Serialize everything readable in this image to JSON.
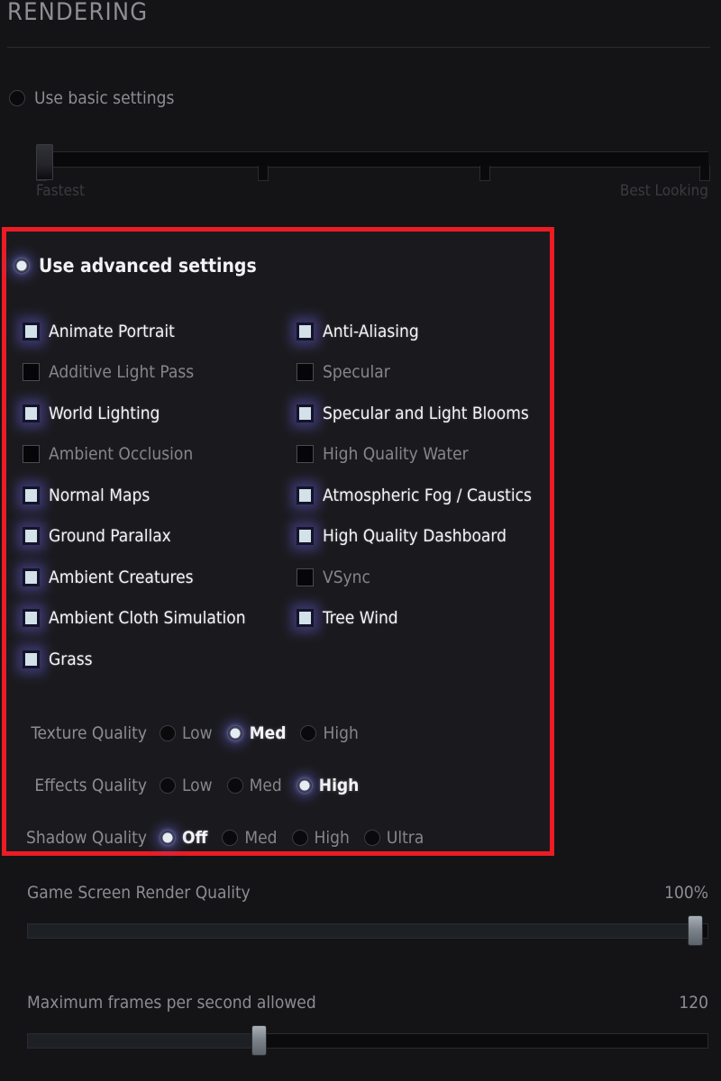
{
  "header": {
    "title": "RENDERING"
  },
  "basic": {
    "radio_label": "Use basic settings",
    "selected": false,
    "slider_min_label": "Fastest",
    "slider_max_label": "Best Looking",
    "slider_value_pct": 0
  },
  "advanced": {
    "radio_label": "Use advanced settings",
    "selected": true,
    "checkboxes_left": [
      {
        "label": "Animate Portrait",
        "checked": true
      },
      {
        "label": "Additive Light Pass",
        "checked": false
      },
      {
        "label": "World Lighting",
        "checked": true
      },
      {
        "label": "Ambient Occlusion",
        "checked": false
      },
      {
        "label": "Normal Maps",
        "checked": true
      },
      {
        "label": "Ground Parallax",
        "checked": true
      },
      {
        "label": "Ambient Creatures",
        "checked": true
      },
      {
        "label": "Ambient Cloth Simulation",
        "checked": true
      },
      {
        "label": "Grass",
        "checked": true
      }
    ],
    "checkboxes_right": [
      {
        "label": "Anti-Aliasing",
        "checked": true
      },
      {
        "label": "Specular",
        "checked": false
      },
      {
        "label": "Specular and Light Blooms",
        "checked": true
      },
      {
        "label": "High Quality Water",
        "checked": false
      },
      {
        "label": "Atmospheric Fog / Caustics",
        "checked": true
      },
      {
        "label": "High Quality Dashboard",
        "checked": true
      },
      {
        "label": "VSync",
        "checked": false
      },
      {
        "label": "Tree Wind",
        "checked": true
      }
    ],
    "quality_rows": [
      {
        "title": "Texture Quality",
        "selected": "Med",
        "options": [
          {
            "label": "Low",
            "selected": false
          },
          {
            "label": "Med",
            "selected": true
          },
          {
            "label": "High",
            "selected": false
          }
        ]
      },
      {
        "title": "Effects Quality",
        "selected": "High",
        "options": [
          {
            "label": "Low",
            "selected": false
          },
          {
            "label": "Med",
            "selected": false
          },
          {
            "label": "High",
            "selected": true
          }
        ]
      },
      {
        "title": "Shadow Quality",
        "selected": "Off",
        "options": [
          {
            "label": "Off",
            "selected": true
          },
          {
            "label": "Med",
            "selected": false
          },
          {
            "label": "High",
            "selected": false
          },
          {
            "label": "Ultra",
            "selected": false
          }
        ]
      }
    ]
  },
  "bottom_sliders": [
    {
      "label": "Game Screen Render Quality",
      "value_text": "100%",
      "value_pct": 98
    },
    {
      "label": "Maximum frames per second allowed",
      "value_text": "120",
      "value_pct": 34
    }
  ],
  "colors": {
    "background": "#141416",
    "panel": "#1a1a1e",
    "highlight_border": "#ec1c24",
    "checked_fill": "#d3e1e9",
    "glow": "#685ed6",
    "label_on": "#f4f4f7",
    "label_off": "#85858c",
    "title": "#8e8e94"
  }
}
